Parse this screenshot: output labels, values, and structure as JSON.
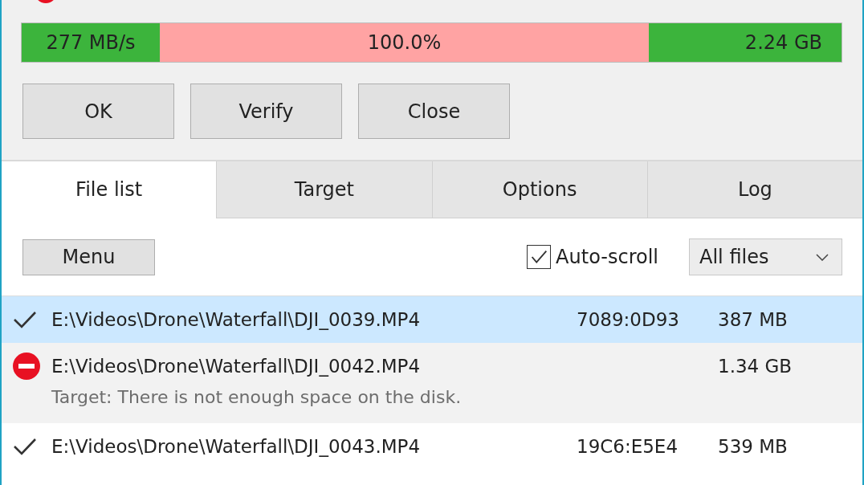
{
  "progress": {
    "speed": "277 MB/s",
    "percent": "100.0%",
    "level": 1,
    "size": "2.24 GB"
  },
  "buttons": [
    "OK",
    "Verify",
    "Close"
  ],
  "tabs": [
    {
      "label": "File list",
      "selected": true
    },
    {
      "label": "Target",
      "selected": false
    },
    {
      "label": "Options",
      "selected": false
    },
    {
      "label": "Log",
      "selected": false
    }
  ],
  "toolbar": {
    "menu": "Menu",
    "auto_scroll": {
      "label": "Auto-scroll",
      "checked": true
    },
    "filter": "All files"
  },
  "files": [
    {
      "kind": "ok",
      "selected": true,
      "path": "E:\\Videos\\Drone\\Waterfall\\DJI_0039.MP4",
      "hash": "7089:0D93",
      "size": "387 MB"
    },
    {
      "kind": "error",
      "selected": false,
      "path": "E:\\Videos\\Drone\\Waterfall\\DJI_0042.MP4",
      "size": "1.34 GB",
      "message": "Target: There is not enough space on the disk."
    },
    {
      "kind": "ok",
      "selected": false,
      "path": "E:\\Videos\\Drone\\Waterfall\\DJI_0043.MP4",
      "hash": "19C6:E5E4",
      "size": "539 MB"
    }
  ]
}
